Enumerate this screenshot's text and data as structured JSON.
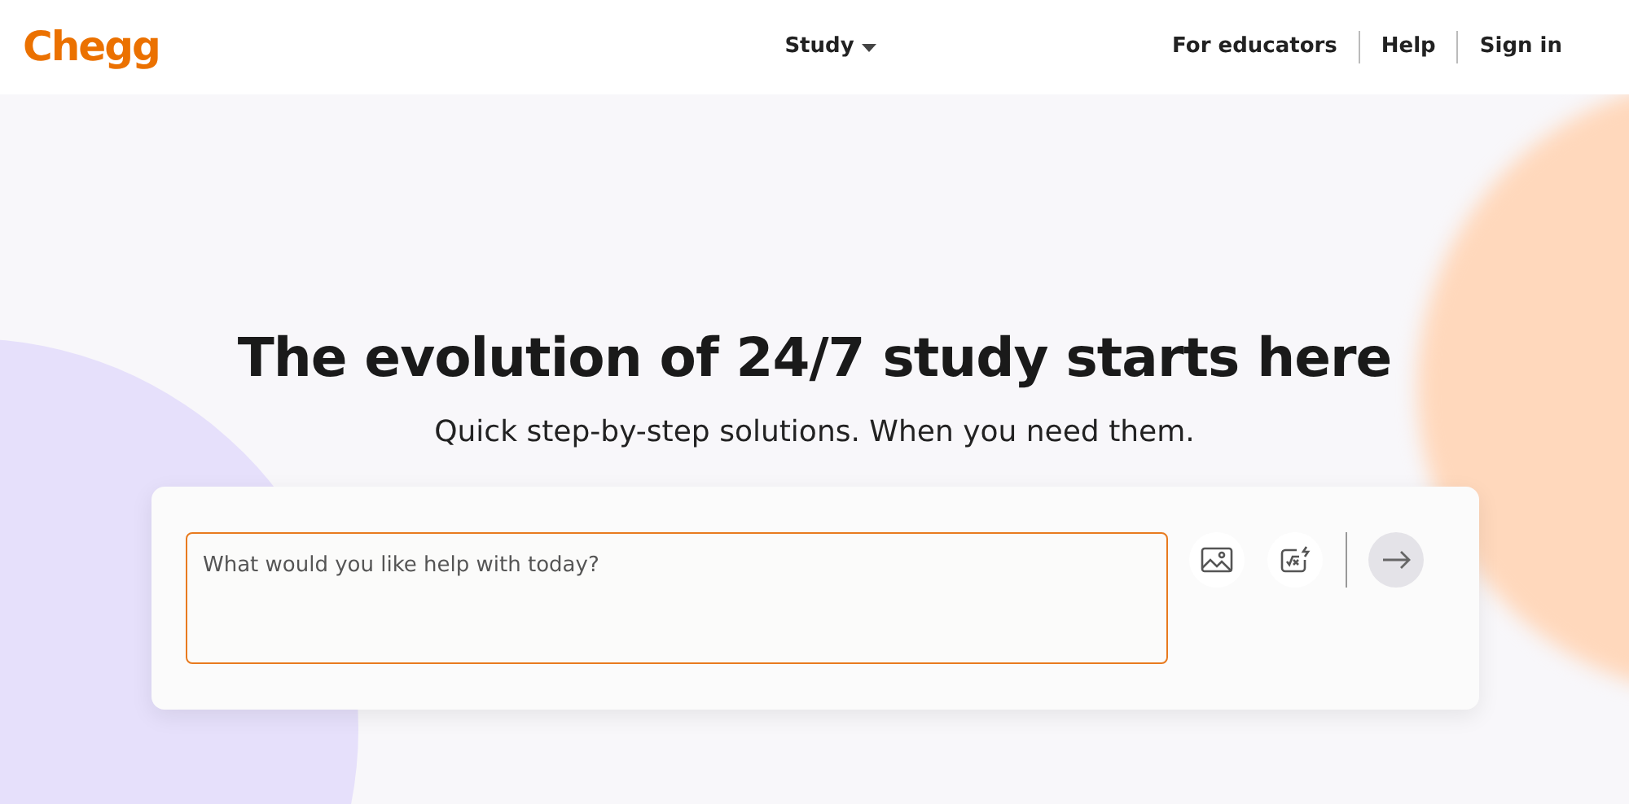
{
  "header": {
    "logo": "Chegg",
    "nav": [
      {
        "label": "Study",
        "has_dropdown": true
      }
    ],
    "links": [
      "For educators",
      "Help",
      "Sign in"
    ]
  },
  "hero": {
    "title": "The evolution of 24/7 study starts here",
    "subtitle": "Quick step-by-step solutions. When you need them."
  },
  "question_box": {
    "placeholder": "What would you like help with today?",
    "submit": {
      "disabled": true
    }
  }
}
